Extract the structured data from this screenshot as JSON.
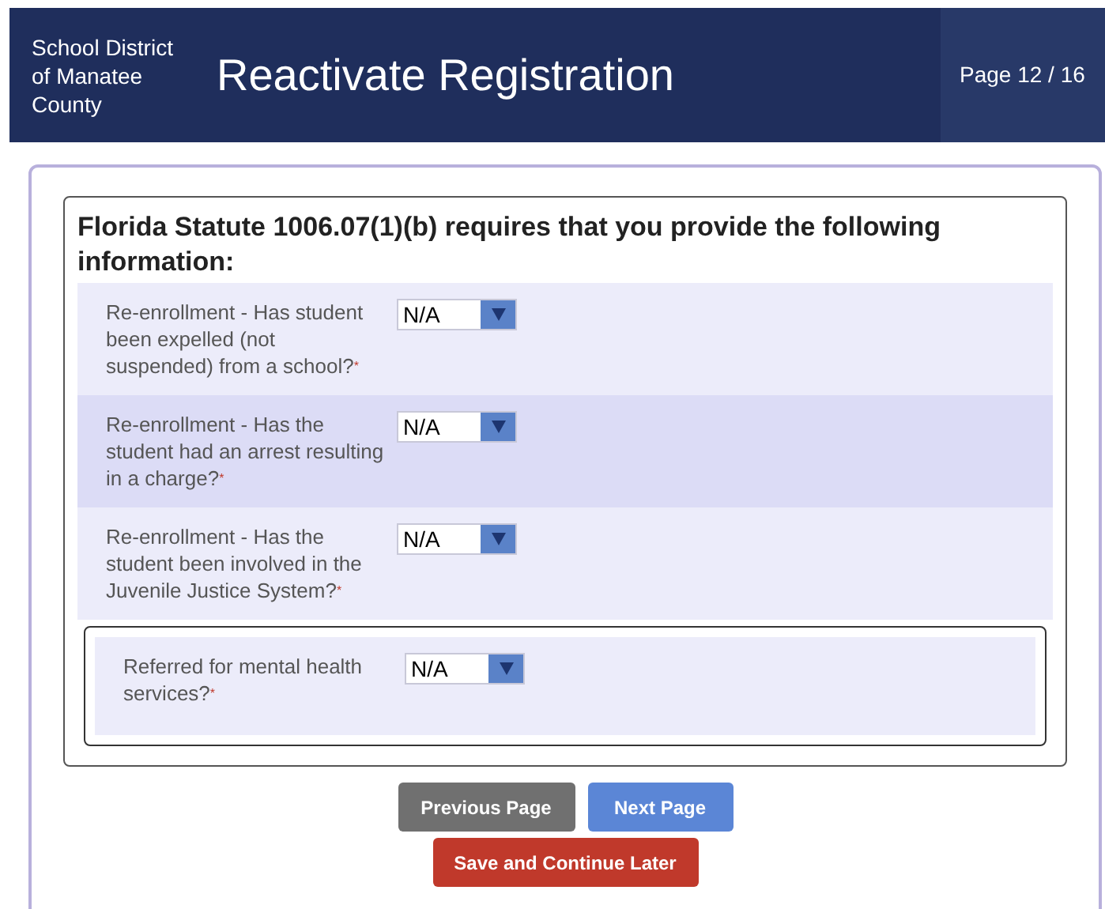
{
  "header": {
    "logo_alt": "School District of Manatee County",
    "title": "Reactivate Registration",
    "page_indicator": "Page 12 / 16"
  },
  "section": {
    "heading": "Florida Statute 1006.07(1)(b) requires that you provide the following information:",
    "questions": [
      {
        "label": "Re-enrollment - Has student been expelled (not suspended) from a school?",
        "required_mark": "*",
        "value": "N/A"
      },
      {
        "label": "Re-enrollment - Has the student had an arrest resulting in a charge?",
        "required_mark": "*",
        "value": "N/A"
      },
      {
        "label": "Re-enrollment - Has the student been involved in the Juvenile Justice System?",
        "required_mark": "*",
        "value": "N/A"
      }
    ],
    "subsection": {
      "questions": [
        {
          "label": "Referred for mental health services?",
          "required_mark": "*",
          "value": "N/A"
        }
      ]
    }
  },
  "buttons": [
    {
      "label": "Previous Page",
      "kind": "secondary"
    },
    {
      "label": "Next Page",
      "kind": "primary"
    },
    {
      "label": "Save and Continue Later",
      "kind": "danger"
    }
  ]
}
